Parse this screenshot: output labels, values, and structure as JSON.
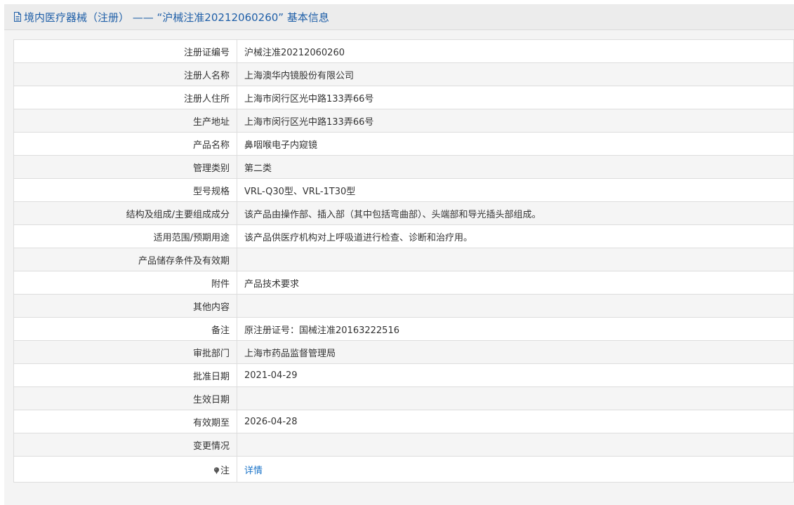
{
  "header": {
    "title": "境内医疗器械（注册） —— “沪械注准20212060260” 基本信息"
  },
  "rows": [
    {
      "label": "注册证编号",
      "value": "沪械注准20212060260"
    },
    {
      "label": "注册人名称",
      "value": "上海澳华内镜股份有限公司"
    },
    {
      "label": "注册人住所",
      "value": "上海市闵行区光中路133弄66号"
    },
    {
      "label": "生产地址",
      "value": "上海市闵行区光中路133弄66号"
    },
    {
      "label": "产品名称",
      "value": "鼻咽喉电子内窥镜"
    },
    {
      "label": "管理类别",
      "value": "第二类"
    },
    {
      "label": "型号规格",
      "value": "VRL-Q30型、VRL-1T30型"
    },
    {
      "label": "结构及组成/主要组成成分",
      "value": "该产品由操作部、插入部（其中包括弯曲部）、头端部和导光插头部组成。"
    },
    {
      "label": "适用范围/预期用途",
      "value": "该产品供医疗机构对上呼吸道进行检查、诊断和治疗用。"
    },
    {
      "label": "产品储存条件及有效期",
      "value": ""
    },
    {
      "label": "附件",
      "value": "产品技术要求"
    },
    {
      "label": "其他内容",
      "value": ""
    },
    {
      "label": "备注",
      "value": "原注册证号：国械注准20163222516"
    },
    {
      "label": "审批部门",
      "value": "上海市药品监督管理局"
    },
    {
      "label": "批准日期",
      "value": "2021-04-29"
    },
    {
      "label": "生效日期",
      "value": ""
    },
    {
      "label": "有效期至",
      "value": "2026-04-28"
    },
    {
      "label": "变更情况",
      "value": ""
    }
  ],
  "note": {
    "label": "注",
    "link_text": "详情"
  },
  "colors": {
    "header_text": "#1f5fa8",
    "link": "#1a73c8",
    "header_bg": "#ececec",
    "border": "#dddddd"
  },
  "icons": {
    "header": "document-icon",
    "note": "pin-icon"
  }
}
